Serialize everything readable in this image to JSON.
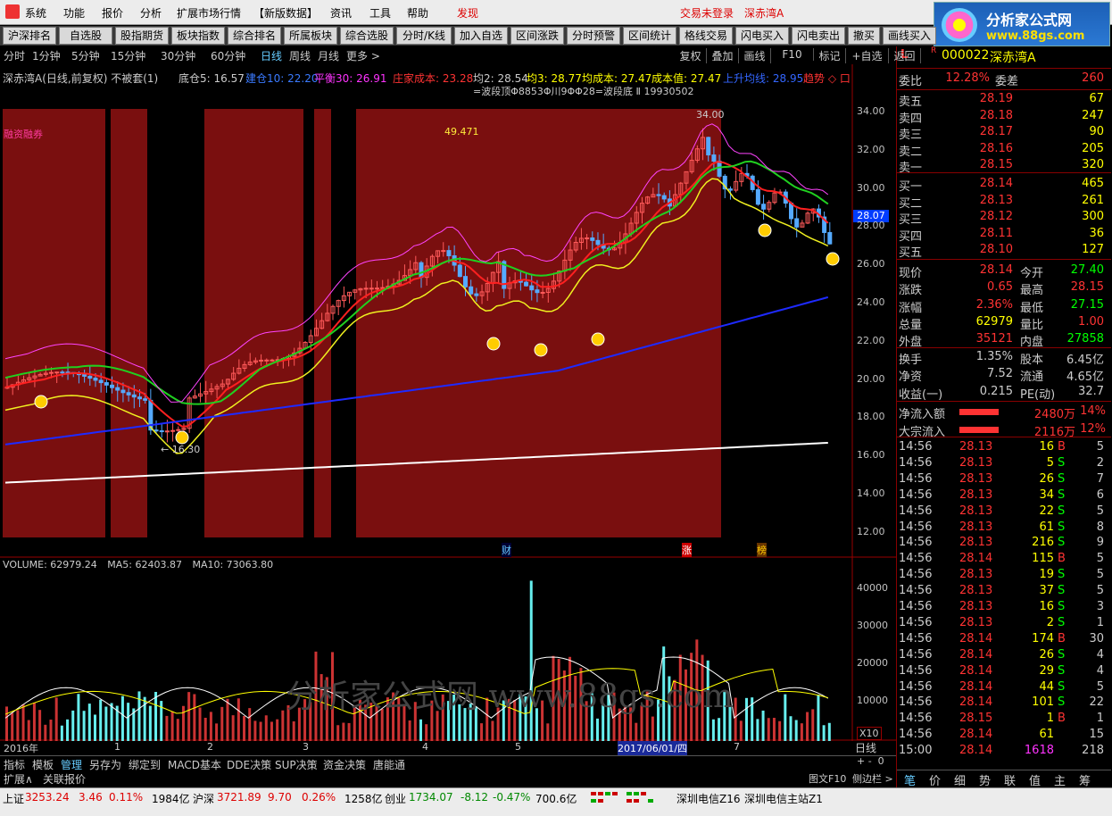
{
  "menu": [
    "系统",
    "功能",
    "报价",
    "分析",
    "扩展市场行情",
    "【新版数据】",
    "资讯",
    "工具",
    "帮助",
    "发现"
  ],
  "login_status": "交易未登录",
  "stock_title": "深赤湾A",
  "ad": {
    "title": "分析家公式网",
    "url": "www.88gs.com"
  },
  "toolbar": [
    "沪深排名",
    "自选股",
    "股指期货",
    "板块指数",
    "综合排名",
    "所属板块",
    "综合选股",
    "分时/K线",
    "加入自选",
    "区间涨跌",
    "分时预警",
    "区间统计",
    "格线交易",
    "闪电买入",
    "闪电卖出",
    "撤买",
    "画线买入"
  ],
  "chart_header": {
    "name": "深赤湾A(日线,前复权) 不被套(1)",
    "cang": "底仓5: 16.57",
    "kangcang": "建仓10: 22.20",
    "pingheng": "平衡30: 26.91",
    "zhuangjia": "庄家成本: 23.28",
    "jun2": "均2: 28.54",
    "jun3": "均3: 28.77",
    "junchengben": "均成本: 27.47",
    "chengbenzhi": "成本值: 27.47",
    "shangsheng": "上升均线: 28.95",
    "qushi": "趋势 ◇ 口"
  },
  "wave_text": "=波段顶Φ8853Φ川9ΦΦ28=波段底 Ⅱ 19930502",
  "periods": [
    "分时",
    "1分钟",
    "5分钟",
    "15分钟",
    "30分钟",
    "60分钟",
    "日线",
    "周线",
    "月线",
    "更多 >"
  ],
  "right_tools": [
    "复权",
    "叠加",
    "画线",
    "F10",
    "标记",
    "+自选",
    "返回"
  ],
  "margin_label": "融资融券",
  "chart_annot": {
    "v1": "49.471",
    "high": "34.00",
    "low": "← 16.30",
    "price": "28.07"
  },
  "y_ticks": [
    "34.00",
    "32.00",
    "30.00",
    "28.00",
    "26.00",
    "24.00",
    "22.00",
    "20.00",
    "18.00",
    "16.00",
    "14.00",
    "12.00"
  ],
  "vol_header": {
    "vol": "VOLUME: 62979.24",
    "ma5": "MA5: 62403.87",
    "ma10": "MA10: 73063.80"
  },
  "vol_ticks": [
    "40000",
    "30000",
    "20000",
    "10000"
  ],
  "vol_unit": "X10",
  "x_labels": [
    "2016年",
    "1",
    "2",
    "3",
    "4",
    "5",
    "2017/06/01/四",
    "7"
  ],
  "markers": [
    "财",
    "涨",
    "榜"
  ],
  "watermark": "分析家公式网 www.88gs.com",
  "bottom_tabs": [
    "指标",
    "模板",
    "管理",
    "另存为",
    "绑定到",
    "MACD基本",
    "DDE决策",
    "SUP决策",
    "资金决策",
    "唐能通"
  ],
  "bottom_tabs2": [
    "扩展∧",
    "关联报价"
  ],
  "day_label": "日线",
  "f10_label": "图文F10",
  "sidebar_label": "侧边栏 >",
  "quote": {
    "code": "000022",
    "name": "深赤湾A",
    "L": "L",
    "R": "R",
    "weibi": "委比",
    "weibi_v": "12.28%",
    "weicha": "委差",
    "weicha_v": "260",
    "sell": [
      {
        "label": "卖五",
        "price": "28.19",
        "vol": "67"
      },
      {
        "label": "卖四",
        "price": "28.18",
        "vol": "247"
      },
      {
        "label": "卖三",
        "price": "28.17",
        "vol": "90"
      },
      {
        "label": "卖二",
        "price": "28.16",
        "vol": "205"
      },
      {
        "label": "卖一",
        "price": "28.15",
        "vol": "320"
      }
    ],
    "buy": [
      {
        "label": "买一",
        "price": "28.14",
        "vol": "465"
      },
      {
        "label": "买二",
        "price": "28.13",
        "vol": "261"
      },
      {
        "label": "买三",
        "price": "28.12",
        "vol": "300"
      },
      {
        "label": "买四",
        "price": "28.11",
        "vol": "36"
      },
      {
        "label": "买五",
        "price": "28.10",
        "vol": "127"
      }
    ],
    "stats": [
      {
        "l1": "现价",
        "v1": "28.14",
        "l2": "今开",
        "v2": "27.40"
      },
      {
        "l1": "涨跌",
        "v1": "0.65",
        "l2": "最高",
        "v2": "28.15"
      },
      {
        "l1": "涨幅",
        "v1": "2.36%",
        "l2": "最低",
        "v2": "27.15"
      },
      {
        "l1": "总量",
        "v1": "62979",
        "l2": "量比",
        "v2": "1.00"
      },
      {
        "l1": "外盘",
        "v1": "35121",
        "l2": "内盘",
        "v2": "27858"
      }
    ],
    "stats2": [
      {
        "l1": "换手",
        "v1": "1.35%",
        "l2": "股本",
        "v2": "6.45亿"
      },
      {
        "l1": "净资",
        "v1": "7.52",
        "l2": "流通",
        "v2": "4.65亿"
      },
      {
        "l1": "收益(一)",
        "v1": "0.215",
        "l2": "PE(动)",
        "v2": "32.7"
      }
    ],
    "flow": [
      {
        "l": "净流入额",
        "v": "2480万",
        "p": "14%"
      },
      {
        "l": "大宗流入",
        "v": "2116万",
        "p": "12%"
      }
    ],
    "ticks": [
      [
        "14:56",
        "28.13",
        "16",
        "B",
        "5"
      ],
      [
        "14:56",
        "28.13",
        "5",
        "S",
        "2"
      ],
      [
        "14:56",
        "28.13",
        "26",
        "S",
        "7"
      ],
      [
        "14:56",
        "28.13",
        "34",
        "S",
        "6"
      ],
      [
        "14:56",
        "28.13",
        "22",
        "S",
        "5"
      ],
      [
        "14:56",
        "28.13",
        "61",
        "S",
        "8"
      ],
      [
        "14:56",
        "28.13",
        "216",
        "S",
        "9"
      ],
      [
        "14:56",
        "28.14",
        "115",
        "B",
        "5"
      ],
      [
        "14:56",
        "28.13",
        "19",
        "S",
        "5"
      ],
      [
        "14:56",
        "28.13",
        "37",
        "S",
        "5"
      ],
      [
        "14:56",
        "28.13",
        "16",
        "S",
        "3"
      ],
      [
        "14:56",
        "28.13",
        "2",
        "S",
        "1"
      ],
      [
        "14:56",
        "28.14",
        "174",
        "B",
        "30"
      ],
      [
        "14:56",
        "28.14",
        "26",
        "S",
        "4"
      ],
      [
        "14:56",
        "28.14",
        "29",
        "S",
        "4"
      ],
      [
        "14:56",
        "28.14",
        "44",
        "S",
        "5"
      ],
      [
        "14:56",
        "28.14",
        "101",
        "S",
        "22"
      ],
      [
        "14:56",
        "28.15",
        "1",
        "B",
        "1"
      ],
      [
        "14:56",
        "28.14",
        "61",
        "",
        "15"
      ],
      [
        "15:00",
        "28.14",
        "1618",
        "",
        "218"
      ]
    ],
    "tabs": [
      "笔",
      "价",
      "细",
      "势",
      "联",
      "值",
      "主",
      "筹"
    ]
  },
  "status": {
    "sh_l": "上证",
    "sh": "3253.24",
    "sh_c": "3.46",
    "sh_p": "0.11%",
    "sh_a": "1984亿",
    "hs_l": "沪深",
    "hs": "3721.89",
    "hs_c": "9.70",
    "hs_p": "0.26%",
    "hs_a": "1258亿",
    "cy_l": "创业",
    "cy": "1734.07",
    "cy_c": "-8.12",
    "cy_p": "-0.47%",
    "cy_a": "700.6亿",
    "srv1": "深圳电信Z16",
    "srv2": "深圳电信主站Z1"
  }
}
